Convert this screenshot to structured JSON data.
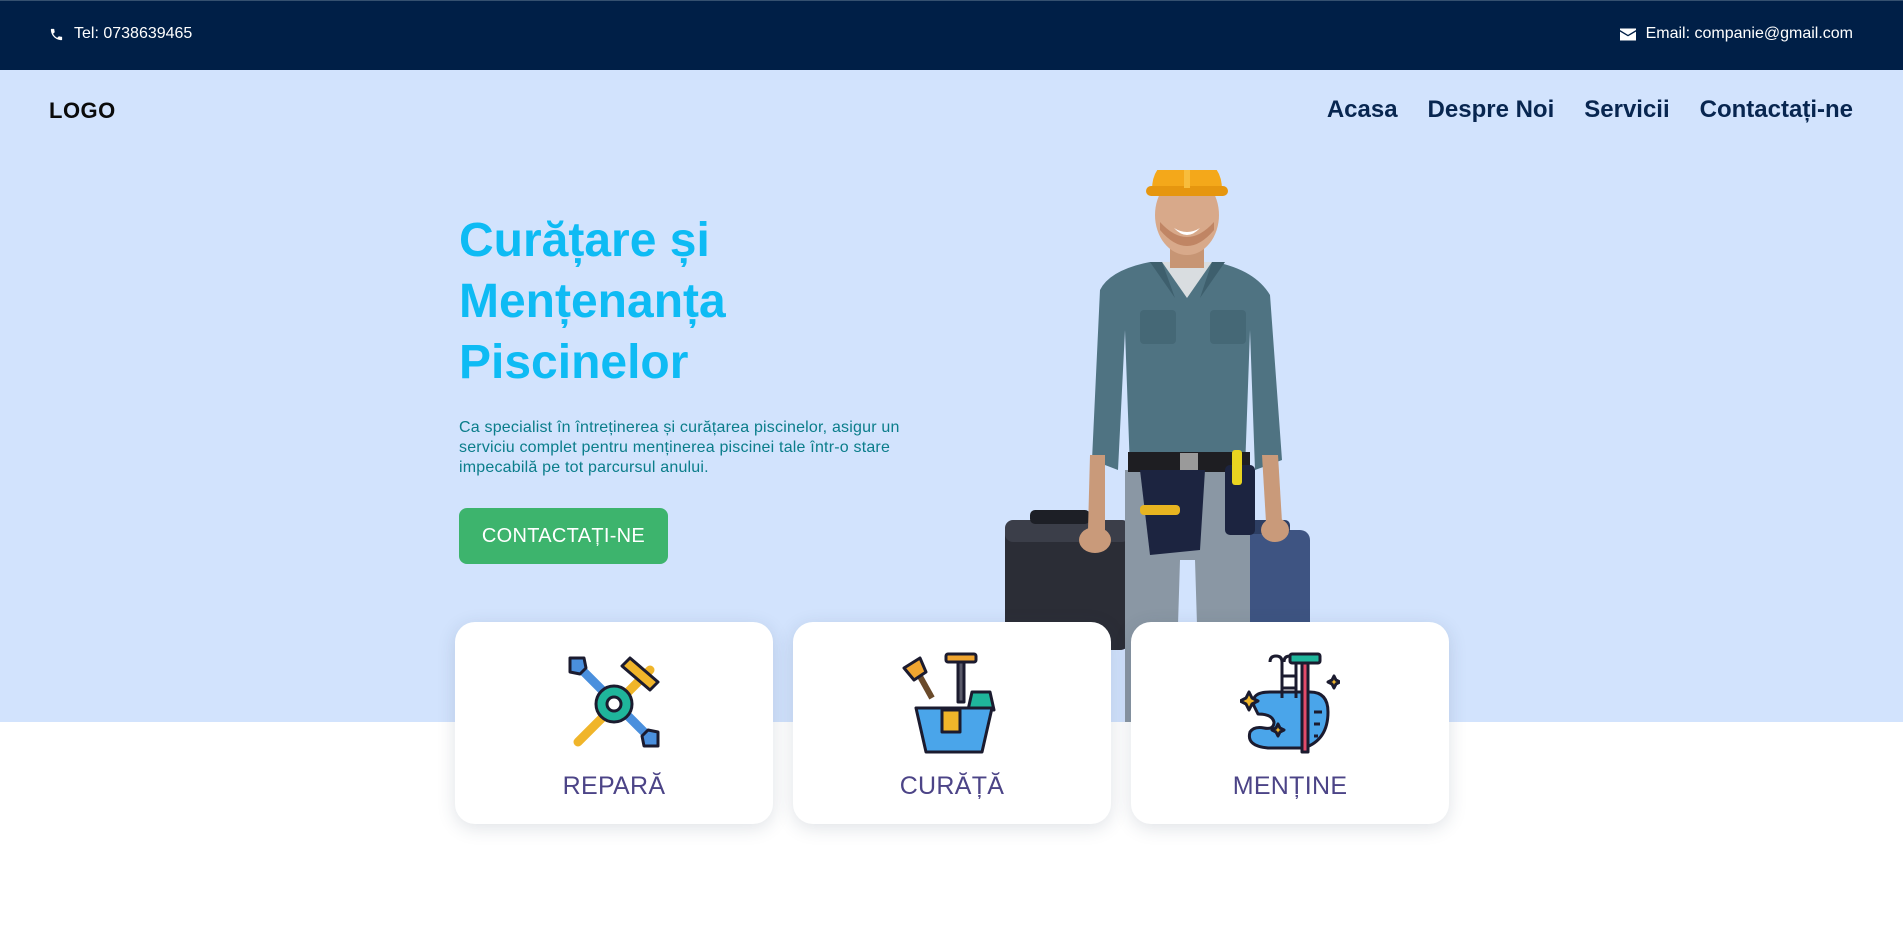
{
  "topbar": {
    "phone": "Tel: 0738639465",
    "email": "Email: companie@gmail.com",
    "phone_icon": "phone-icon",
    "email_icon": "envelope-icon"
  },
  "header": {
    "logo": "LOGO",
    "nav": [
      "Acasa",
      "Despre Noi",
      "Servicii",
      "Contactați-ne"
    ]
  },
  "hero": {
    "title_lines": [
      "Curățare și",
      "Mențenanța",
      "Piscinelor"
    ],
    "description": "Ca specialist în întreținerea și curățarea piscinelor, asigur un serviciu complet pentru menținerea piscinei tale într-o stare impecabilă pe tot parcursul anului.",
    "cta": "CONTACTAȚI-NE",
    "image": "worker-with-toolbox-image"
  },
  "services": [
    {
      "label": "REPARĂ",
      "icon": "repair-tools-icon"
    },
    {
      "label": "CURĂȚĂ",
      "icon": "cleaning-bucket-icon"
    },
    {
      "label": "MENȚINE",
      "icon": "pool-maintenance-icon"
    }
  ],
  "colors": {
    "topbar_bg": "#001f47",
    "hero_bg": "#d2e3fd",
    "title": "#0ebbf4",
    "cta": "#3db46d",
    "nav": "#082650",
    "card_label": "#4c4487"
  }
}
